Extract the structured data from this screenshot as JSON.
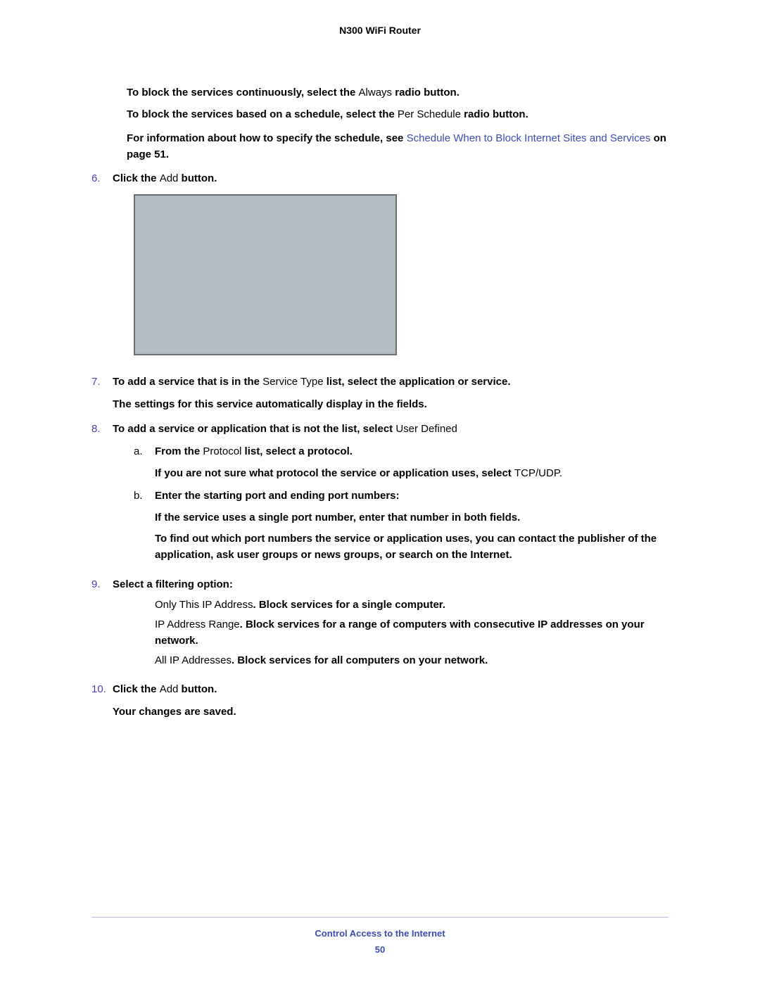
{
  "header": {
    "title": "N300 WiFi Router"
  },
  "intro": {
    "line1_b1": "To block the services continuously, select the ",
    "line1_plain": "Always",
    "line1_b2": " radio button.",
    "line2_b1": "To block the services based on a schedule, select the ",
    "line2_plain": "Per Schedule",
    "line2_b2": " radio button.",
    "line3_b1": "For information about how to specify the schedule, see ",
    "line3_link": "Schedule When to Block Internet Sites and Services",
    "line3_b2": " on page 51."
  },
  "step6": {
    "num": "6.",
    "b1": "Click the ",
    "plain": "Add",
    "b2": " button."
  },
  "step7": {
    "num": "7.",
    "b1": "To add a service that is in the ",
    "plain": "Service Type",
    "b2": " list, select the application or service.",
    "p2": "The settings for this service automatically display in the fields."
  },
  "step8": {
    "num": "8.",
    "b1": "To add a service or application that is not the list, select ",
    "plain": "User Defined",
    "a_num": "a.",
    "a_b1": "From the ",
    "a_plain": "Protocol",
    "a_b2": " list, select a protocol.",
    "a_p2_b1": "If you are not sure what protocol the service or application uses, select ",
    "a_p2_plain": "TCP/UDP.",
    "b_num": "b.",
    "b_b1": "Enter the starting port and ending port numbers:",
    "b_p2": "If the service uses a single port number, enter that number in both fields.",
    "b_p3": "To find out which port numbers the service or application uses, you can contact the publisher of the application, ask user groups or news groups, or search on the Internet."
  },
  "step9": {
    "num": "9.",
    "b1": "Select a filtering option:",
    "opt1_plain": "Only This IP Address",
    "opt1_b": ". Block services for a single computer.",
    "opt2_plain": "IP Address Range",
    "opt2_b": ". Block services for a range of computers with consecutive IP addresses on your network.",
    "opt3_plain": "All IP Addresses",
    "opt3_b": ". Block services for all computers on your network."
  },
  "step10": {
    "num": "10.",
    "b1": "Click the ",
    "plain": "Add",
    "b2": " button.",
    "p2": "Your changes are saved."
  },
  "footer": {
    "text": "Control Access to the Internet",
    "page": "50"
  }
}
